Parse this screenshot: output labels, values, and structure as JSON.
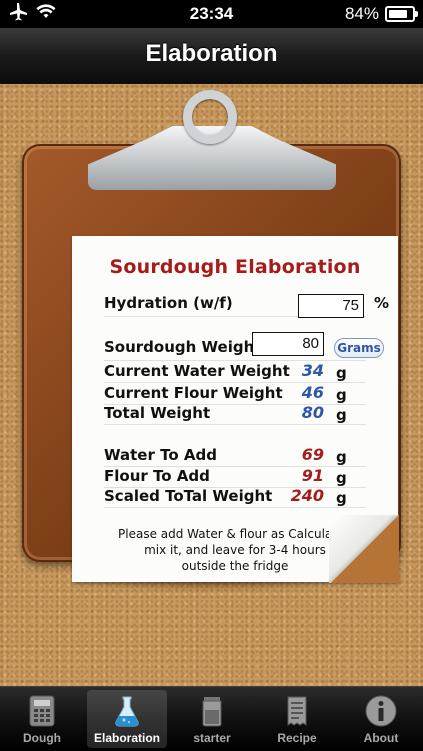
{
  "status": {
    "time": "23:34",
    "battery": "84%",
    "battery_level": 0.84
  },
  "nav": {
    "title": "Elaboration"
  },
  "paper": {
    "title": "Sourdough Elaboration",
    "hydration": {
      "label": "Hydration (w/f)",
      "value": "75",
      "unit": "%"
    },
    "sourdough_weight": {
      "label": "Sourdough Weight",
      "value": "80",
      "unit_button": "Grams"
    },
    "current_water": {
      "label": "Current Water Weight",
      "value": "34",
      "unit": "g"
    },
    "current_flour": {
      "label": "Current Flour Weight",
      "value": "46",
      "unit": "g"
    },
    "total_weight": {
      "label": "Total Weight",
      "value": "80",
      "unit": "g"
    },
    "water_to_add": {
      "label": "Water To Add",
      "value": "69",
      "unit": "g"
    },
    "flour_to_add": {
      "label": "Flour To Add",
      "value": "91",
      "unit": "g"
    },
    "scaled_total": {
      "label": "Scaled ToTal Weight",
      "value": "240",
      "unit": "g"
    },
    "note_lines": [
      "Please add Water & flour as Calculated",
      "mix it, and leave for 3-4 hours",
      "outside the fridge"
    ]
  },
  "tabs": [
    {
      "label": "Dough",
      "icon": "calculator-icon",
      "active": false
    },
    {
      "label": "Elaboration",
      "icon": "flask-icon",
      "active": true
    },
    {
      "label": "starter",
      "icon": "jar-icon",
      "active": false
    },
    {
      "label": "Recipe",
      "icon": "receipt-icon",
      "active": false
    },
    {
      "label": "About",
      "icon": "info-icon",
      "active": false
    }
  ],
  "colors": {
    "title_red": "#a51c1c",
    "value_blue": "#2f55a6",
    "cork": "#c89a5e",
    "board": "#7d3e17"
  }
}
